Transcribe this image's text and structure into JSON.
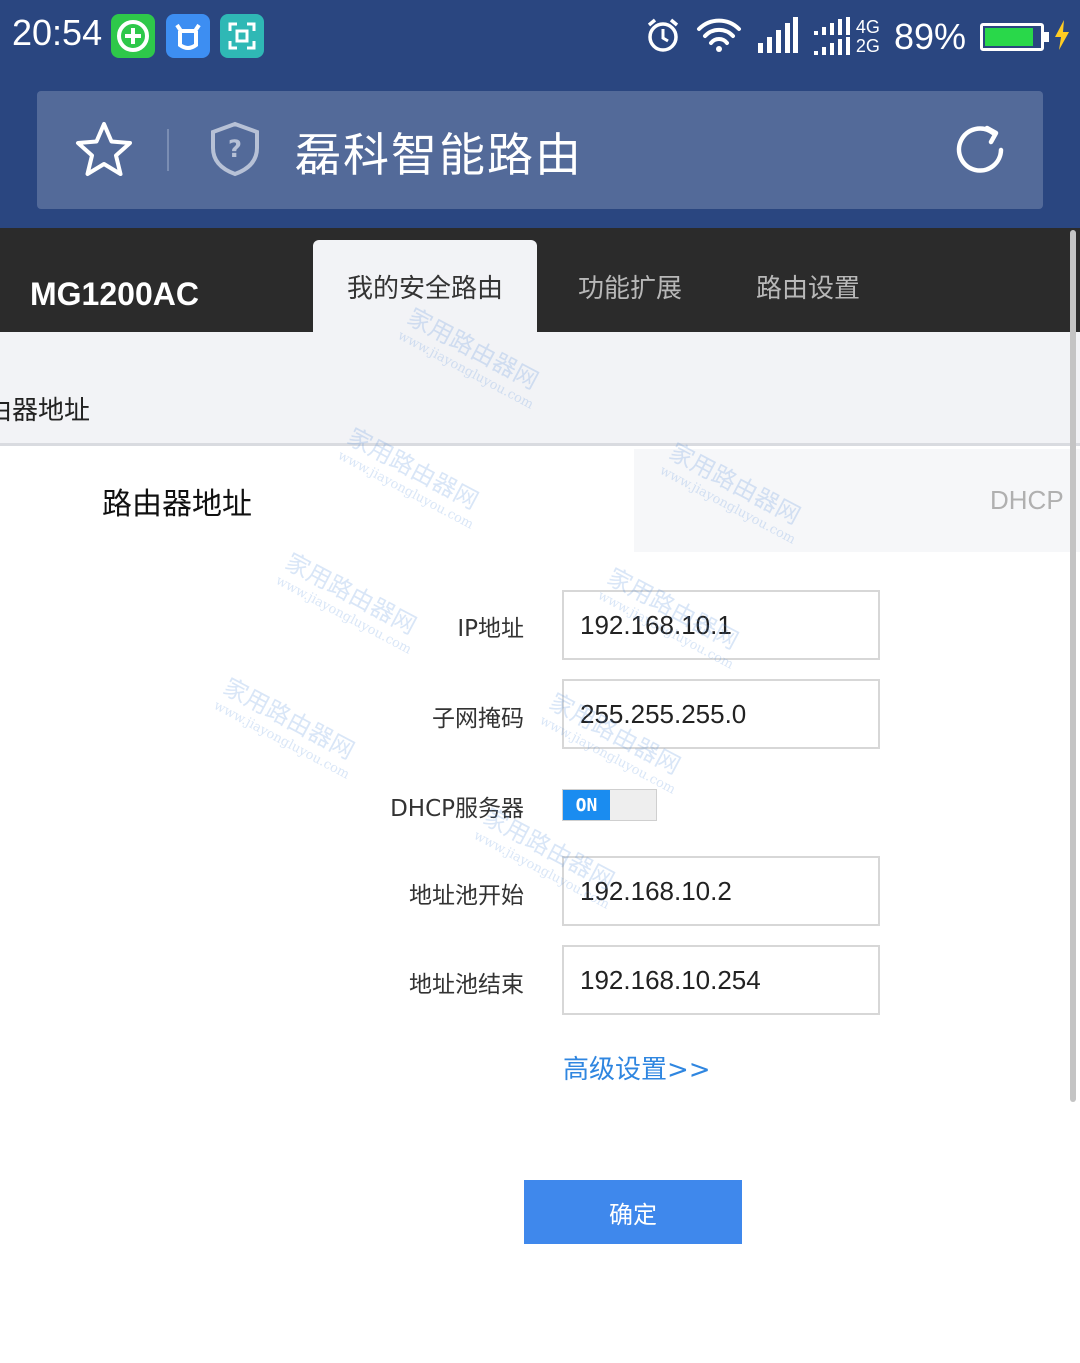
{
  "status_bar": {
    "time": "20:54",
    "app_icons": [
      {
        "name": "plus-app-icon",
        "color": "#2ec84a"
      },
      {
        "name": "cow-app-icon",
        "color": "#3d8ef2"
      },
      {
        "name": "scan-app-icon",
        "color": "#2fb8b5"
      }
    ],
    "network_4g": "4G",
    "network_2g": "2G",
    "battery_percent": "89%",
    "battery_level": 0.89
  },
  "browser": {
    "page_title": "磊科智能路由"
  },
  "router": {
    "model": "MG1200AC",
    "tabs": [
      {
        "label": "我的安全路由",
        "active": true
      },
      {
        "label": "功能扩展",
        "active": false
      },
      {
        "label": "路由设置",
        "active": false
      }
    ],
    "subheader": "由器地址"
  },
  "panel": {
    "section_title": "路由器地址",
    "side_tab": "DHCP",
    "ip_label": "IP地址",
    "ip_value": "192.168.10.1",
    "mask_label": "子网掩码",
    "mask_value": "255.255.255.0",
    "dhcp_label": "DHCP服务器",
    "dhcp_state": "ON",
    "pool_start_label": "地址池开始",
    "pool_start_value": "192.168.10.2",
    "pool_end_label": "地址池结束",
    "pool_end_value": "192.168.10.254",
    "advanced_link": "高级设置>>",
    "confirm_button": "确定"
  },
  "watermark": {
    "text": "家用路由器网",
    "url": "www.jiayongluyou.com"
  }
}
